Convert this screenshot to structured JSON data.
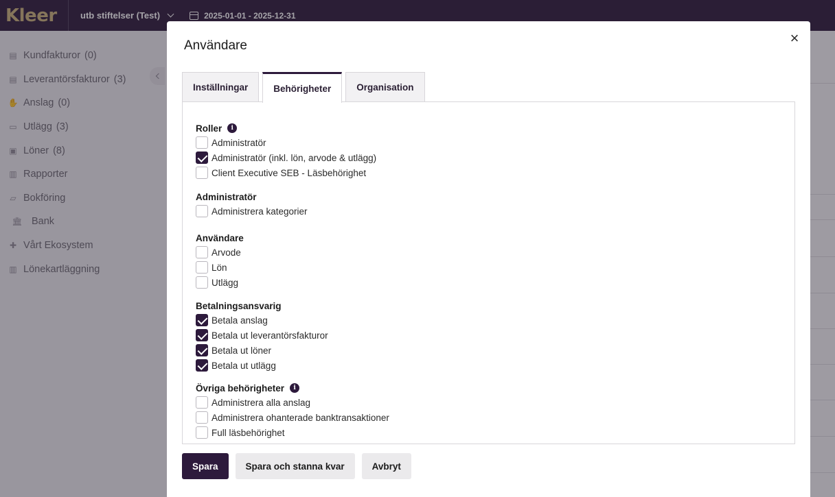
{
  "topbar": {
    "logo": "Kleer",
    "company": "utb stiftelser (Test)",
    "date_range": "2025-01-01 - 2025-12-31"
  },
  "sidebar": {
    "items": [
      {
        "label": "Kundfakturor",
        "count": "(0)",
        "icon": "invoice-icon"
      },
      {
        "label": "Leverantörsfakturor",
        "count": "(3)",
        "icon": "supplier-invoice-icon"
      },
      {
        "label": "Anslag",
        "count": "(0)",
        "icon": "grant-icon"
      },
      {
        "label": "Utlägg",
        "count": "(3)",
        "icon": "expense-icon"
      },
      {
        "label": "Löner",
        "count": "(8)",
        "icon": "salary-icon"
      },
      {
        "label": "Rapporter",
        "count": "",
        "icon": "reports-icon"
      },
      {
        "label": "Bokföring",
        "count": "",
        "icon": "bookkeeping-icon"
      },
      {
        "label": "Bank",
        "count": "",
        "icon": "bank-icon"
      },
      {
        "label": "Vårt Ekosystem",
        "count": "",
        "icon": "ecosystem-icon"
      },
      {
        "label": "Lönekartläggning",
        "count": "",
        "icon": "salary-survey-icon"
      }
    ]
  },
  "modal": {
    "title": "Användare",
    "close": "×",
    "tabs": [
      {
        "label": "Inställningar",
        "active": false
      },
      {
        "label": "Behörigheter",
        "active": true
      },
      {
        "label": "Organisation",
        "active": false
      }
    ],
    "sections": {
      "roller": {
        "title": "Roller",
        "items": [
          {
            "label": "Administratör",
            "checked": false
          },
          {
            "label": "Administratör (inkl. lön, arvode & utlägg)",
            "checked": true
          },
          {
            "label": "Client Executive SEB - Läsbehörighet",
            "checked": false
          }
        ]
      },
      "administrator": {
        "title": "Administratör",
        "items": [
          {
            "label": "Administrera kategorier",
            "checked": false
          }
        ]
      },
      "anvandare": {
        "title": "Användare",
        "items": [
          {
            "label": "Arvode",
            "checked": false
          },
          {
            "label": "Lön",
            "checked": false
          },
          {
            "label": "Utlägg",
            "checked": false
          }
        ]
      },
      "betalning": {
        "title": "Betalningsansvarig",
        "items": [
          {
            "label": "Betala anslag",
            "checked": true
          },
          {
            "label": "Betala ut leverantörsfakturor",
            "checked": true
          },
          {
            "label": "Betala ut löner",
            "checked": true
          },
          {
            "label": "Betala ut utlägg",
            "checked": true
          }
        ]
      },
      "ovriga": {
        "title": "Övriga behörigheter",
        "items": [
          {
            "label": "Administrera alla anslag",
            "checked": false
          },
          {
            "label": "Administrera ohanterade banktransaktioner",
            "checked": false
          },
          {
            "label": "Full läsbehörighet",
            "checked": false
          }
        ]
      }
    },
    "footer": {
      "save": "Spara",
      "save_stay": "Spara och stanna kvar",
      "cancel": "Avbryt"
    }
  },
  "colors": {
    "brand": "#2d1a3c",
    "logo_gold": "#c9b07a"
  }
}
